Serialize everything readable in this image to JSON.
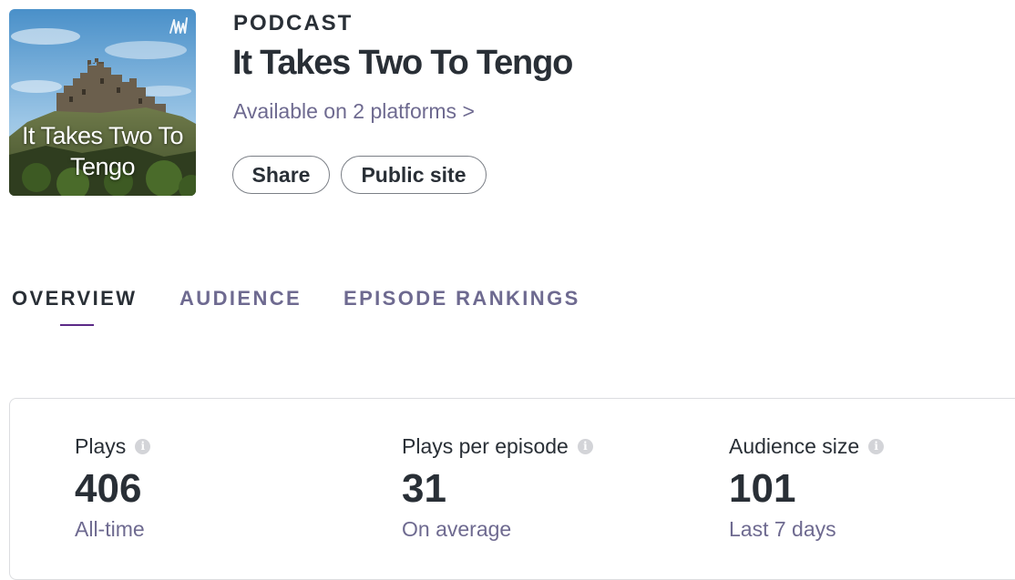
{
  "podcast": {
    "eyebrow": "PODCAST",
    "title": "It Takes Two To Tengo",
    "cover_text": "It Takes Two To Tengo",
    "platforms_link": "Available on 2 platforms >",
    "share_label": "Share",
    "public_site_label": "Public site"
  },
  "tabs": [
    {
      "label": "OVERVIEW",
      "active": true
    },
    {
      "label": "AUDIENCE",
      "active": false
    },
    {
      "label": "EPISODE RANKINGS",
      "active": false
    }
  ],
  "stats": [
    {
      "label": "Plays",
      "value": "406",
      "caption": "All-time"
    },
    {
      "label": "Plays per episode",
      "value": "31",
      "caption": "On average"
    },
    {
      "label": "Audience size",
      "value": "101",
      "caption": "Last 7 days"
    }
  ],
  "icons": {
    "info": "i"
  },
  "colors": {
    "text_primary": "#292f36",
    "text_secondary": "#6e6a90",
    "tab_indicator": "#5b2a87",
    "border": "#dcdde0"
  }
}
